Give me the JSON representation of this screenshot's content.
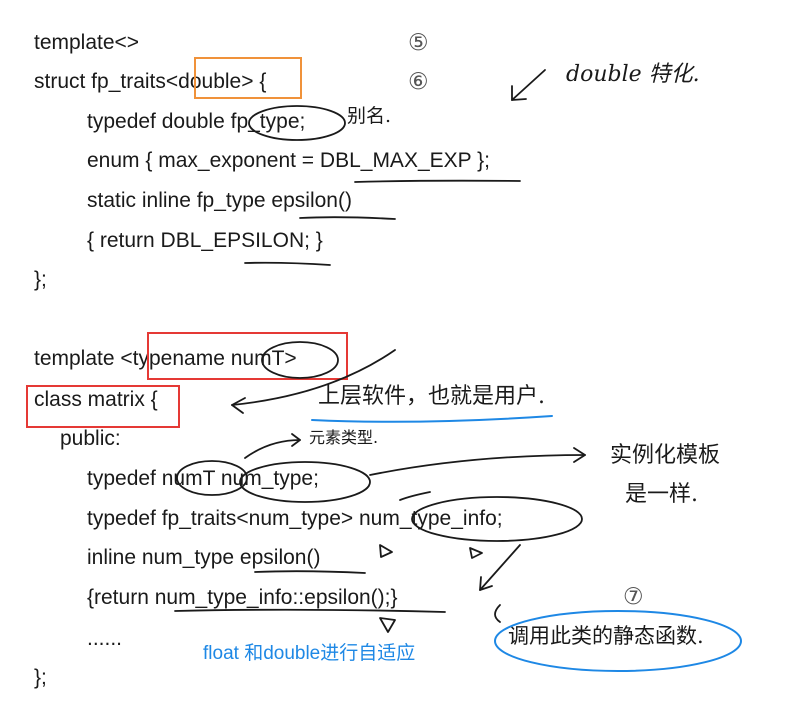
{
  "code": {
    "l1": "template<>",
    "l2_pre": "struct fp_traits",
    "l2_box": "<double>",
    "l2_post": " {",
    "l3": "typedef double fp_type;",
    "l4": "enum { max_exponent = DBL_MAX_EXP };",
    "l5": "static inline fp_type epsilon()",
    "l6": "{ return DBL_EPSILON; }",
    "l7": "};",
    "l8_pre": "template ",
    "l8_box": "<typename numT>",
    "l9_box": "class matrix {",
    "l10": "public:",
    "l11": "typedef numT num_type;",
    "l12": "typedef fp_traits<num_type> num_type_info;",
    "l13": "inline num_type epsilon()",
    "l14": "{return num_type_info::epsilon();}",
    "l15": "......",
    "l16": "};"
  },
  "markers": {
    "m5": "⑤",
    "m6": "⑥",
    "m7": "⑦"
  },
  "notes": {
    "double_special": "double 特化.",
    "alias": "别名.",
    "upper_software": "上层软件，也就是用户.",
    "element_type": "元素类型.",
    "instantiate_1": "实例化模板",
    "instantiate_2": "是一样.",
    "static_func": "调用此类的静态函数.",
    "adaptive": "float 和double进行自适应"
  },
  "colors": {
    "orange_box": "#f0923a",
    "red_box": "#e53935",
    "blue_ink": "#1e88e5",
    "black_ink": "#1a1a1a"
  }
}
